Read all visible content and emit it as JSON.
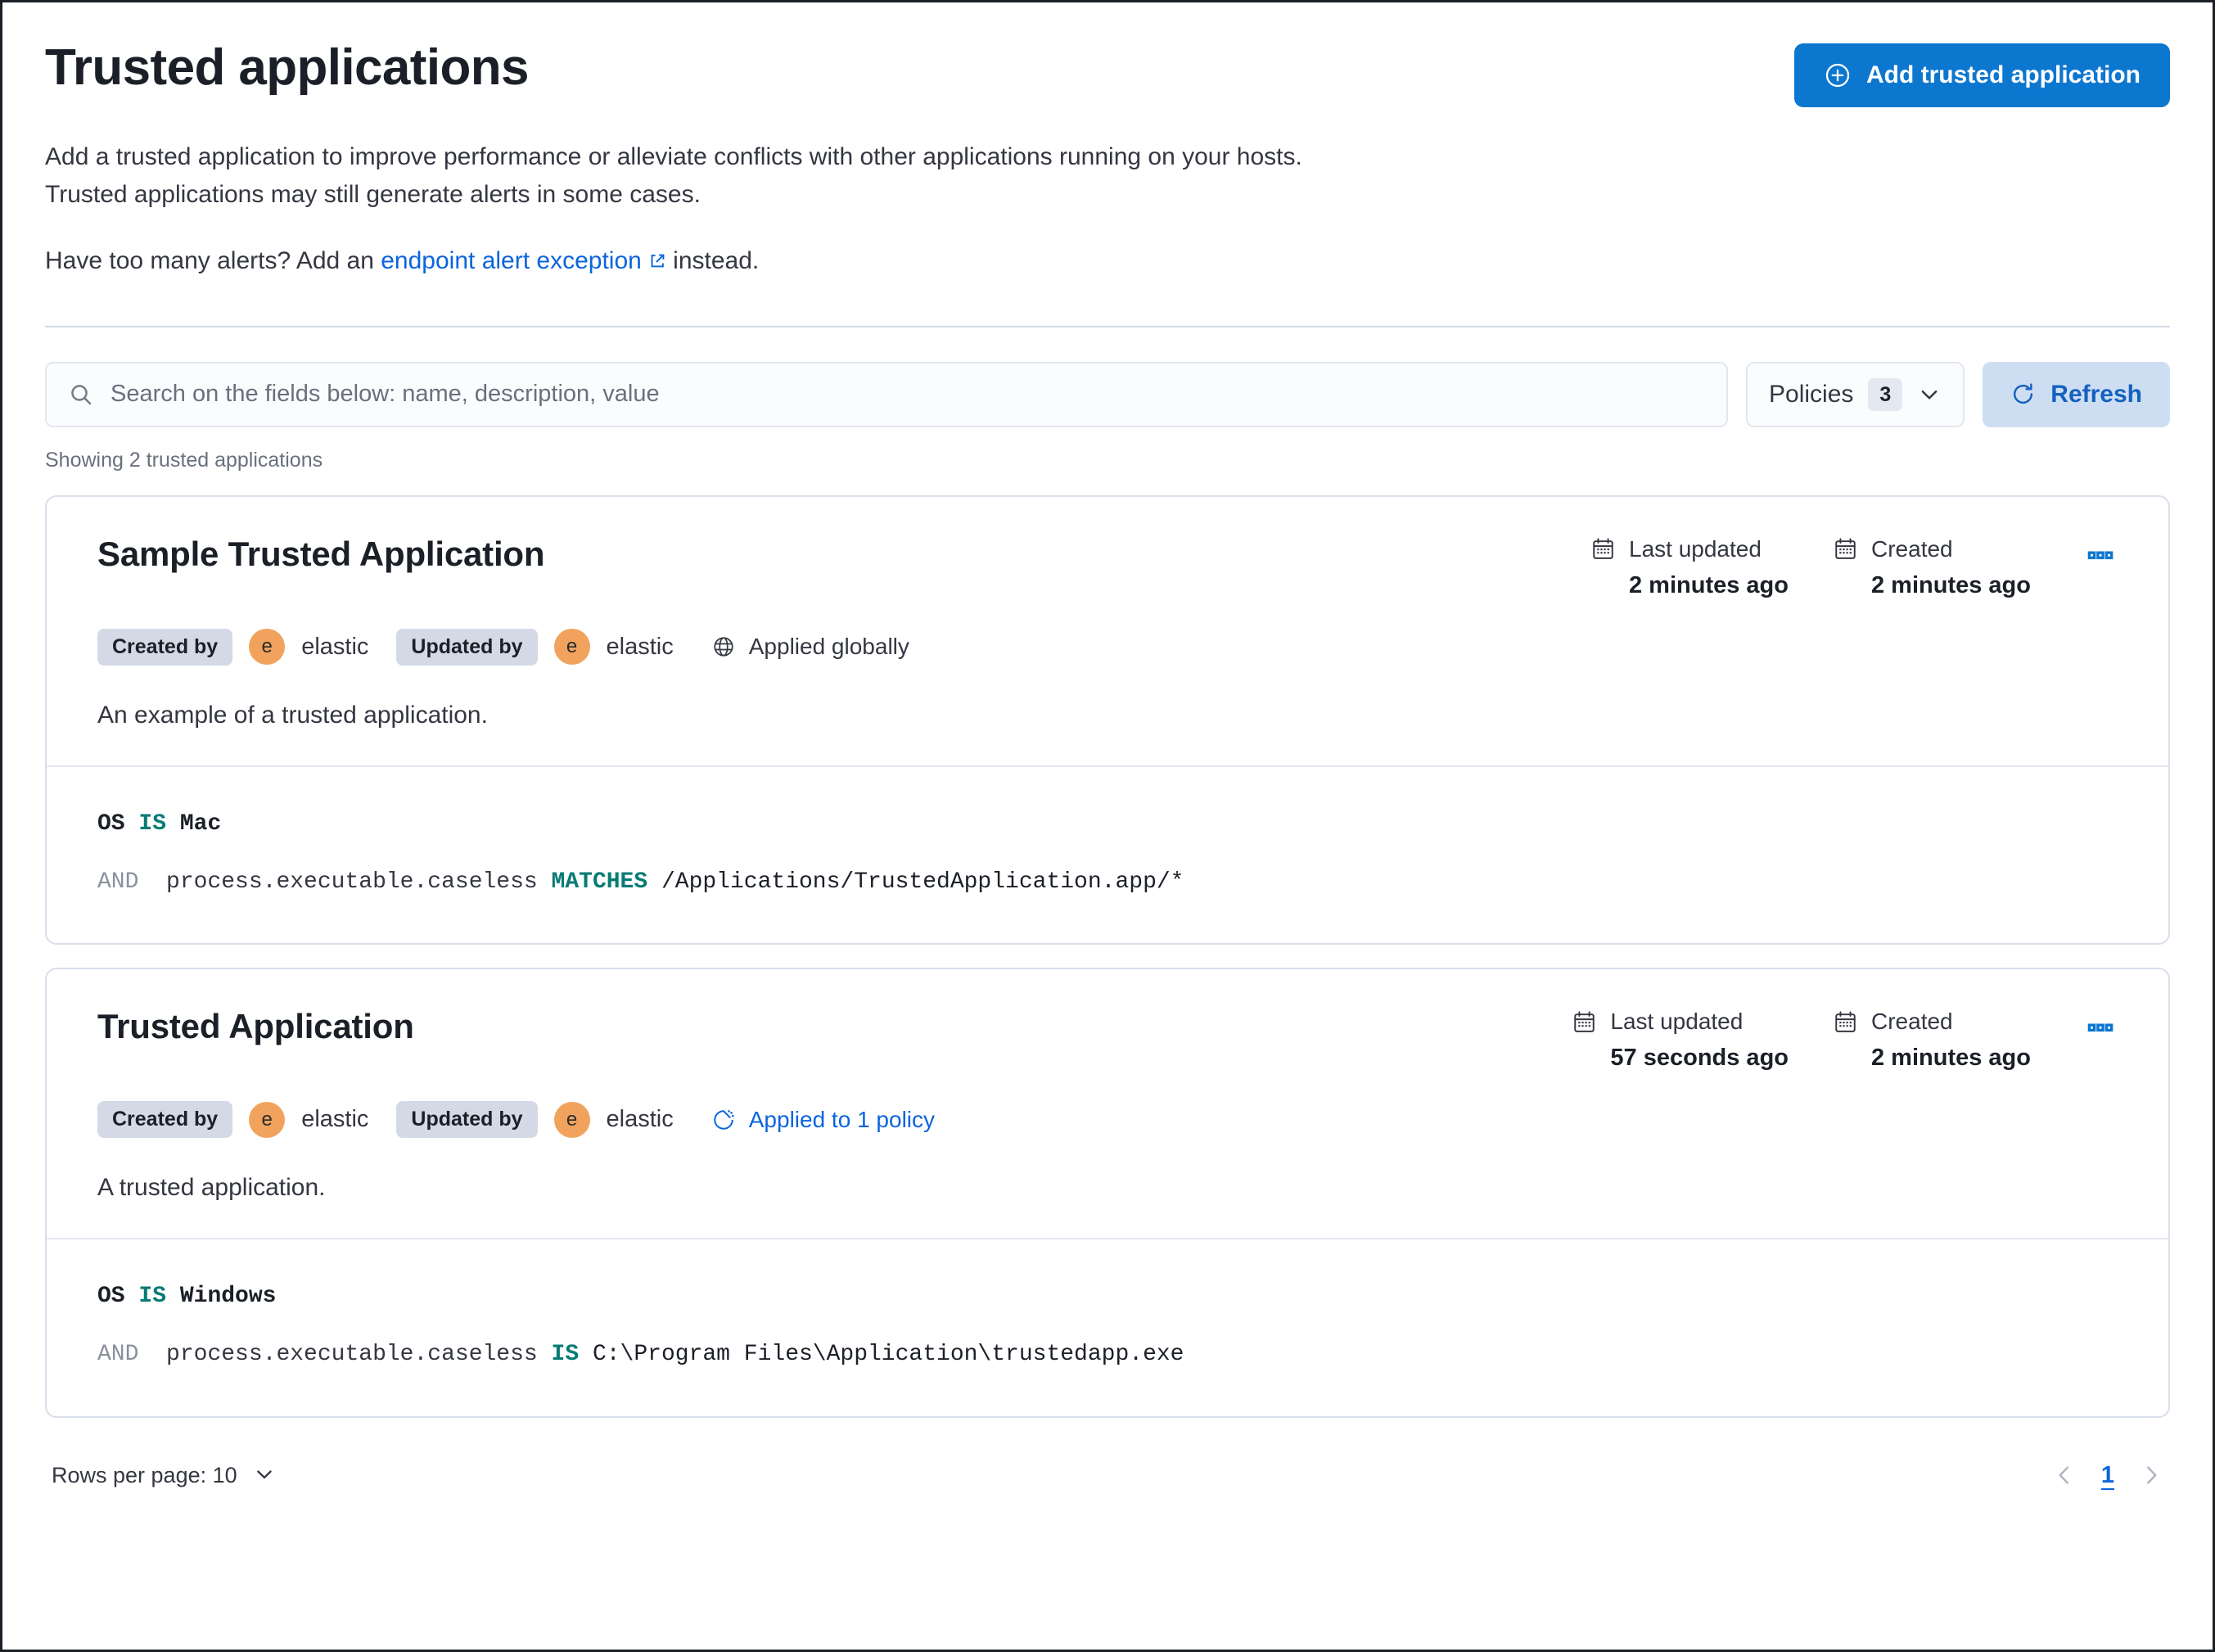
{
  "header": {
    "title": "Trusted applications",
    "add_button": "Add trusted application",
    "add_button_icon": "plus-in-circle-icon",
    "accent_color": "#0c77cf"
  },
  "intro": {
    "paragraph1": "Add a trusted application to improve performance or alleviate conflicts with other applications running on your hosts. Trusted applications may still generate alerts in some cases.",
    "paragraph2_before": "Have too many alerts? Add an ",
    "link_text": "endpoint alert exception",
    "link_icon": "external-link-icon",
    "paragraph2_after": " instead."
  },
  "search": {
    "placeholder": "Search on the fields below: name, description, value",
    "value": "",
    "icon": "search-icon"
  },
  "policies": {
    "label": "Policies",
    "count": "3",
    "icon": "chevron-down-icon"
  },
  "refresh": {
    "label": "Refresh",
    "icon": "refresh-icon",
    "bg_color": "#cddef3",
    "text_color": "#1661bf"
  },
  "showing": "Showing 2 trusted applications",
  "cards": [
    {
      "title": "Sample Trusted Application",
      "created_by_label": "Created by",
      "created_by_user": "elastic",
      "created_by_avatar": "e",
      "updated_by_label": "Updated by",
      "updated_by_user": "elastic",
      "updated_by_avatar": "e",
      "applied_text": "Applied globally",
      "applied_icon": "globe-icon",
      "applied_is_link": false,
      "last_updated_label": "Last updated",
      "last_updated_value": "2 minutes ago",
      "created_label": "Created",
      "created_value": "2 minutes ago",
      "menu_icon": "boxes-horizontal-icon",
      "description": "An example of a trusted application.",
      "criteria": {
        "os_keyword": "OS",
        "os_operator": "IS",
        "os_value": "Mac",
        "and_keyword": "AND",
        "field": "process.executable.caseless",
        "operator": "MATCHES",
        "value": "/Applications/TrustedApplication.app/*"
      }
    },
    {
      "title": "Trusted Application",
      "created_by_label": "Created by",
      "created_by_user": "elastic",
      "created_by_avatar": "e",
      "updated_by_label": "Updated by",
      "updated_by_user": "elastic",
      "updated_by_avatar": "e",
      "applied_text": "Applied to 1 policy",
      "applied_icon": "partial-pie-icon",
      "applied_is_link": true,
      "last_updated_label": "Last updated",
      "last_updated_value": "57 seconds ago",
      "created_label": "Created",
      "created_value": "2 minutes ago",
      "menu_icon": "boxes-horizontal-icon",
      "description": "A trusted application.",
      "criteria": {
        "os_keyword": "OS",
        "os_operator": "IS",
        "os_value": "Windows",
        "and_keyword": "AND",
        "field": "process.executable.caseless",
        "operator": "IS",
        "value": "C:\\Program Files\\Application\\trustedapp.exe"
      }
    }
  ],
  "footer": {
    "rows_per_page": "Rows per page: 10",
    "rows_icon": "chevron-down-icon",
    "prev_icon": "chevron-left-icon",
    "page_number": "1",
    "next_icon": "chevron-right-icon"
  }
}
